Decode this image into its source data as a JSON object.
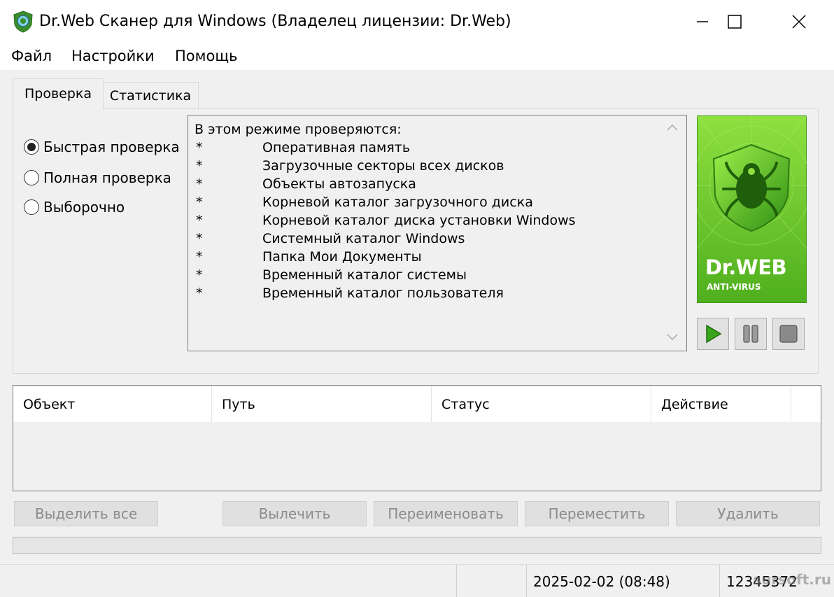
{
  "window": {
    "title": "Dr.Web Сканер для Windows (Владелец лицензии: Dr.Web)",
    "icon": "drweb-spider-icon"
  },
  "menu": [
    "Файл",
    "Настройки",
    "Помощь"
  ],
  "tabs": [
    {
      "label": "Проверка",
      "active": true
    },
    {
      "label": "Статистика",
      "active": false
    }
  ],
  "scan_modes": [
    {
      "label": "Быстрая проверка",
      "selected": true
    },
    {
      "label": "Полная проверка",
      "selected": false
    },
    {
      "label": "Выборочно",
      "selected": false
    }
  ],
  "info": {
    "heading": "В этом режиме проверяются:",
    "bullet": "*",
    "items": [
      "Оперативная память",
      "Загрузочные секторы всех дисков",
      "Объекты автозапуска",
      "Корневой каталог загрузочного диска",
      "Корневой каталог диска установки Windows",
      "Системный каталог Windows",
      "Папка Мои Документы",
      "Временный каталог системы",
      "Временный каталог пользователя"
    ]
  },
  "logo": {
    "brand": "Dr.WEB",
    "tagline": "ANTI-VIRUS",
    "accent": "#5cb82a"
  },
  "table": {
    "columns": [
      "Объект",
      "Путь",
      "Статус",
      "Действие"
    ]
  },
  "actions": [
    "Выделить все",
    "Вылечить",
    "Переименовать",
    "Переместить",
    "Удалить"
  ],
  "status": {
    "datetime": "2025-02-02 (08:48)",
    "count": "12345372"
  },
  "watermark": "sursoft.ru"
}
